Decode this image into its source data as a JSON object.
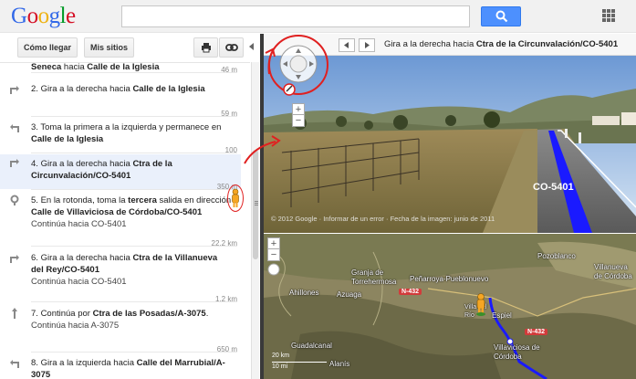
{
  "header": {
    "logo": "Google",
    "logo_letters": [
      {
        "ch": "G",
        "color": "#3369e8"
      },
      {
        "ch": "o",
        "color": "#d50f25"
      },
      {
        "ch": "o",
        "color": "#eeb211"
      },
      {
        "ch": "g",
        "color": "#3369e8"
      },
      {
        "ch": "l",
        "color": "#009925"
      },
      {
        "ch": "e",
        "color": "#d50f25"
      }
    ],
    "search_value": "",
    "search_icon": "search-icon",
    "apps_icon": "apps-grid-icon"
  },
  "toolbar": {
    "directions_label": "Cómo llegar",
    "my_places_label": "Mis sitios",
    "print_icon": "printer-icon",
    "link_icon": "link-icon"
  },
  "steps": [
    {
      "num": "",
      "pre": "",
      "bold1": "Seneca",
      "mid": " hacia ",
      "bold2": "Calle de la Iglesia",
      "tail": "",
      "continue": "",
      "dist": "46 m",
      "icon": "turn-right-icon"
    },
    {
      "num": "2.",
      "pre": "Gira a la derecha hacia ",
      "bold1": "Calle de la Iglesia",
      "mid": "",
      "bold2": "",
      "tail": "",
      "continue": "",
      "dist": "59 m",
      "icon": "turn-right-icon"
    },
    {
      "num": "3.",
      "pre": "Toma la primera a la izquierda y permanece en ",
      "bold1": "Calle de la Iglesia",
      "mid": "",
      "bold2": "",
      "tail": "",
      "continue": "",
      "dist": "100",
      "icon": "turn-left-icon"
    },
    {
      "num": "4.",
      "pre": "Gira a la derecha hacia ",
      "bold1": "Ctra de la Circunvalación/CO-5401",
      "mid": "",
      "bold2": "",
      "tail": "",
      "continue": "",
      "dist": "350 m",
      "icon": "turn-right-icon"
    },
    {
      "num": "5.",
      "pre": "En la rotonda, toma la ",
      "bold1": "tercera",
      "mid": " salida en dirección ",
      "bold2": "Calle de Villaviciosa de Córdoba/CO-5401",
      "tail": "",
      "continue": "Continúa hacia CO-5401",
      "dist": "22,2 km",
      "icon": "roundabout-icon"
    },
    {
      "num": "6.",
      "pre": "Gira a la derecha hacia ",
      "bold1": "Ctra de la Villanueva del Rey/CO-5401",
      "mid": "",
      "bold2": "",
      "tail": "",
      "continue": "Continúa hacia CO-5401",
      "dist": "1,2 km",
      "icon": "turn-right-icon"
    },
    {
      "num": "7.",
      "pre": "Continúa por ",
      "bold1": "Ctra de las Posadas/A-3075",
      "mid": "",
      "bold2": "",
      "tail": ".",
      "continue": "Continúa hacia A-3075",
      "dist": "650 m",
      "icon": "straight-icon"
    },
    {
      "num": "8.",
      "pre": "Gira a la izquierda hacia ",
      "bold1": "Calle del Marrubial/A-3075",
      "mid": "",
      "bold2": "",
      "tail": "",
      "continue": "",
      "dist": "",
      "icon": "turn-left-icon"
    }
  ],
  "streetview": {
    "title_pre": "Gira a la derecha hacia ",
    "title_bold": "Ctra de la Circunvalación/CO-5401",
    "copyright": "© 2012 Google · Informar de un error · Fecha de la imagen: junio de 2011",
    "road_sign": "CO-5401",
    "prev_icon": "prev-step-icon",
    "next_icon": "next-step-icon",
    "compass_icon": "navigation-compass-icon",
    "zoom_in": "+",
    "zoom_out": "−"
  },
  "map": {
    "labels": [
      "Pozoblanco",
      "Villanueva de Córdoba",
      "Peñarroya-Pueblonuevo",
      "Granja de Torrehermosa",
      "Azuaga",
      "Ahillones",
      "Espiel",
      "Villaviciosa de Córdoba",
      "Guadalcanal",
      "Alanís",
      "Villa del Río"
    ],
    "road_badges": [
      "N-432",
      "N-432"
    ],
    "scale_km": "20 km",
    "scale_mi": "10 mi",
    "zoom_in": "+",
    "zoom_out": "−"
  },
  "colors": {
    "route": "#1a1aff",
    "accent": "#4d90fe",
    "annotation": "#e02020",
    "selected_row": "#eaf0fb"
  }
}
